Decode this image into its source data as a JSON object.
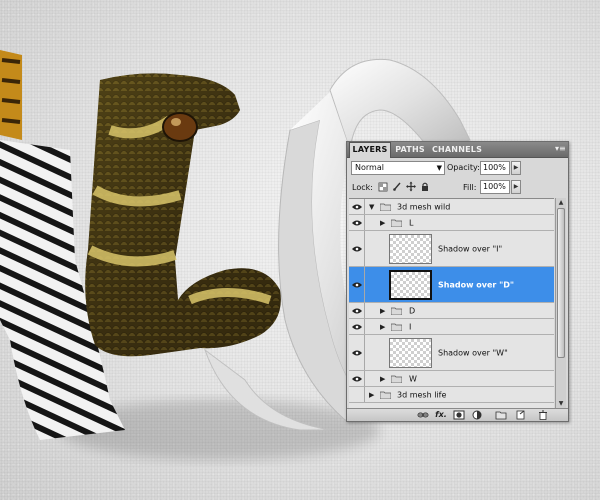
{
  "panel": {
    "tabs": [
      {
        "label": "LAYERS",
        "active": true
      },
      {
        "label": "PATHS",
        "active": false
      },
      {
        "label": "CHANNELS",
        "active": false
      }
    ],
    "blend_mode": "Normal",
    "opacity_label": "Opacity:",
    "opacity_value": "100%",
    "lock_label": "Lock:",
    "fill_label": "Fill:",
    "fill_value": "100%",
    "layers": [
      {
        "name": "3d mesh wild",
        "type": "group",
        "expanded": true,
        "visible": true
      },
      {
        "name": "L",
        "type": "group",
        "expanded": false,
        "visible": true
      },
      {
        "name": "Shadow over \"I\"",
        "type": "layer",
        "visible": true,
        "selected": false
      },
      {
        "name": "Shadow over \"D\"",
        "type": "layer",
        "visible": true,
        "selected": true
      },
      {
        "name": "D",
        "type": "group",
        "expanded": false,
        "visible": true
      },
      {
        "name": "I",
        "type": "group",
        "expanded": false,
        "visible": true
      },
      {
        "name": "Shadow over \"W\"",
        "type": "layer",
        "visible": true,
        "selected": false
      },
      {
        "name": "W",
        "type": "group",
        "expanded": false,
        "visible": true
      },
      {
        "name": "3d mesh life",
        "type": "group",
        "expanded": false,
        "visible": false
      }
    ],
    "footer_icons": [
      "link-icon",
      "fx-icon",
      "mask-icon",
      "adjustment-icon",
      "new-group-icon",
      "new-layer-icon",
      "trash-icon"
    ],
    "footer_fx_label": "fx.",
    "colors": {
      "selection": "#3d8ee9",
      "panel_bg": "#d8d8d8",
      "tab_bar": "#7a7a7a"
    }
  }
}
